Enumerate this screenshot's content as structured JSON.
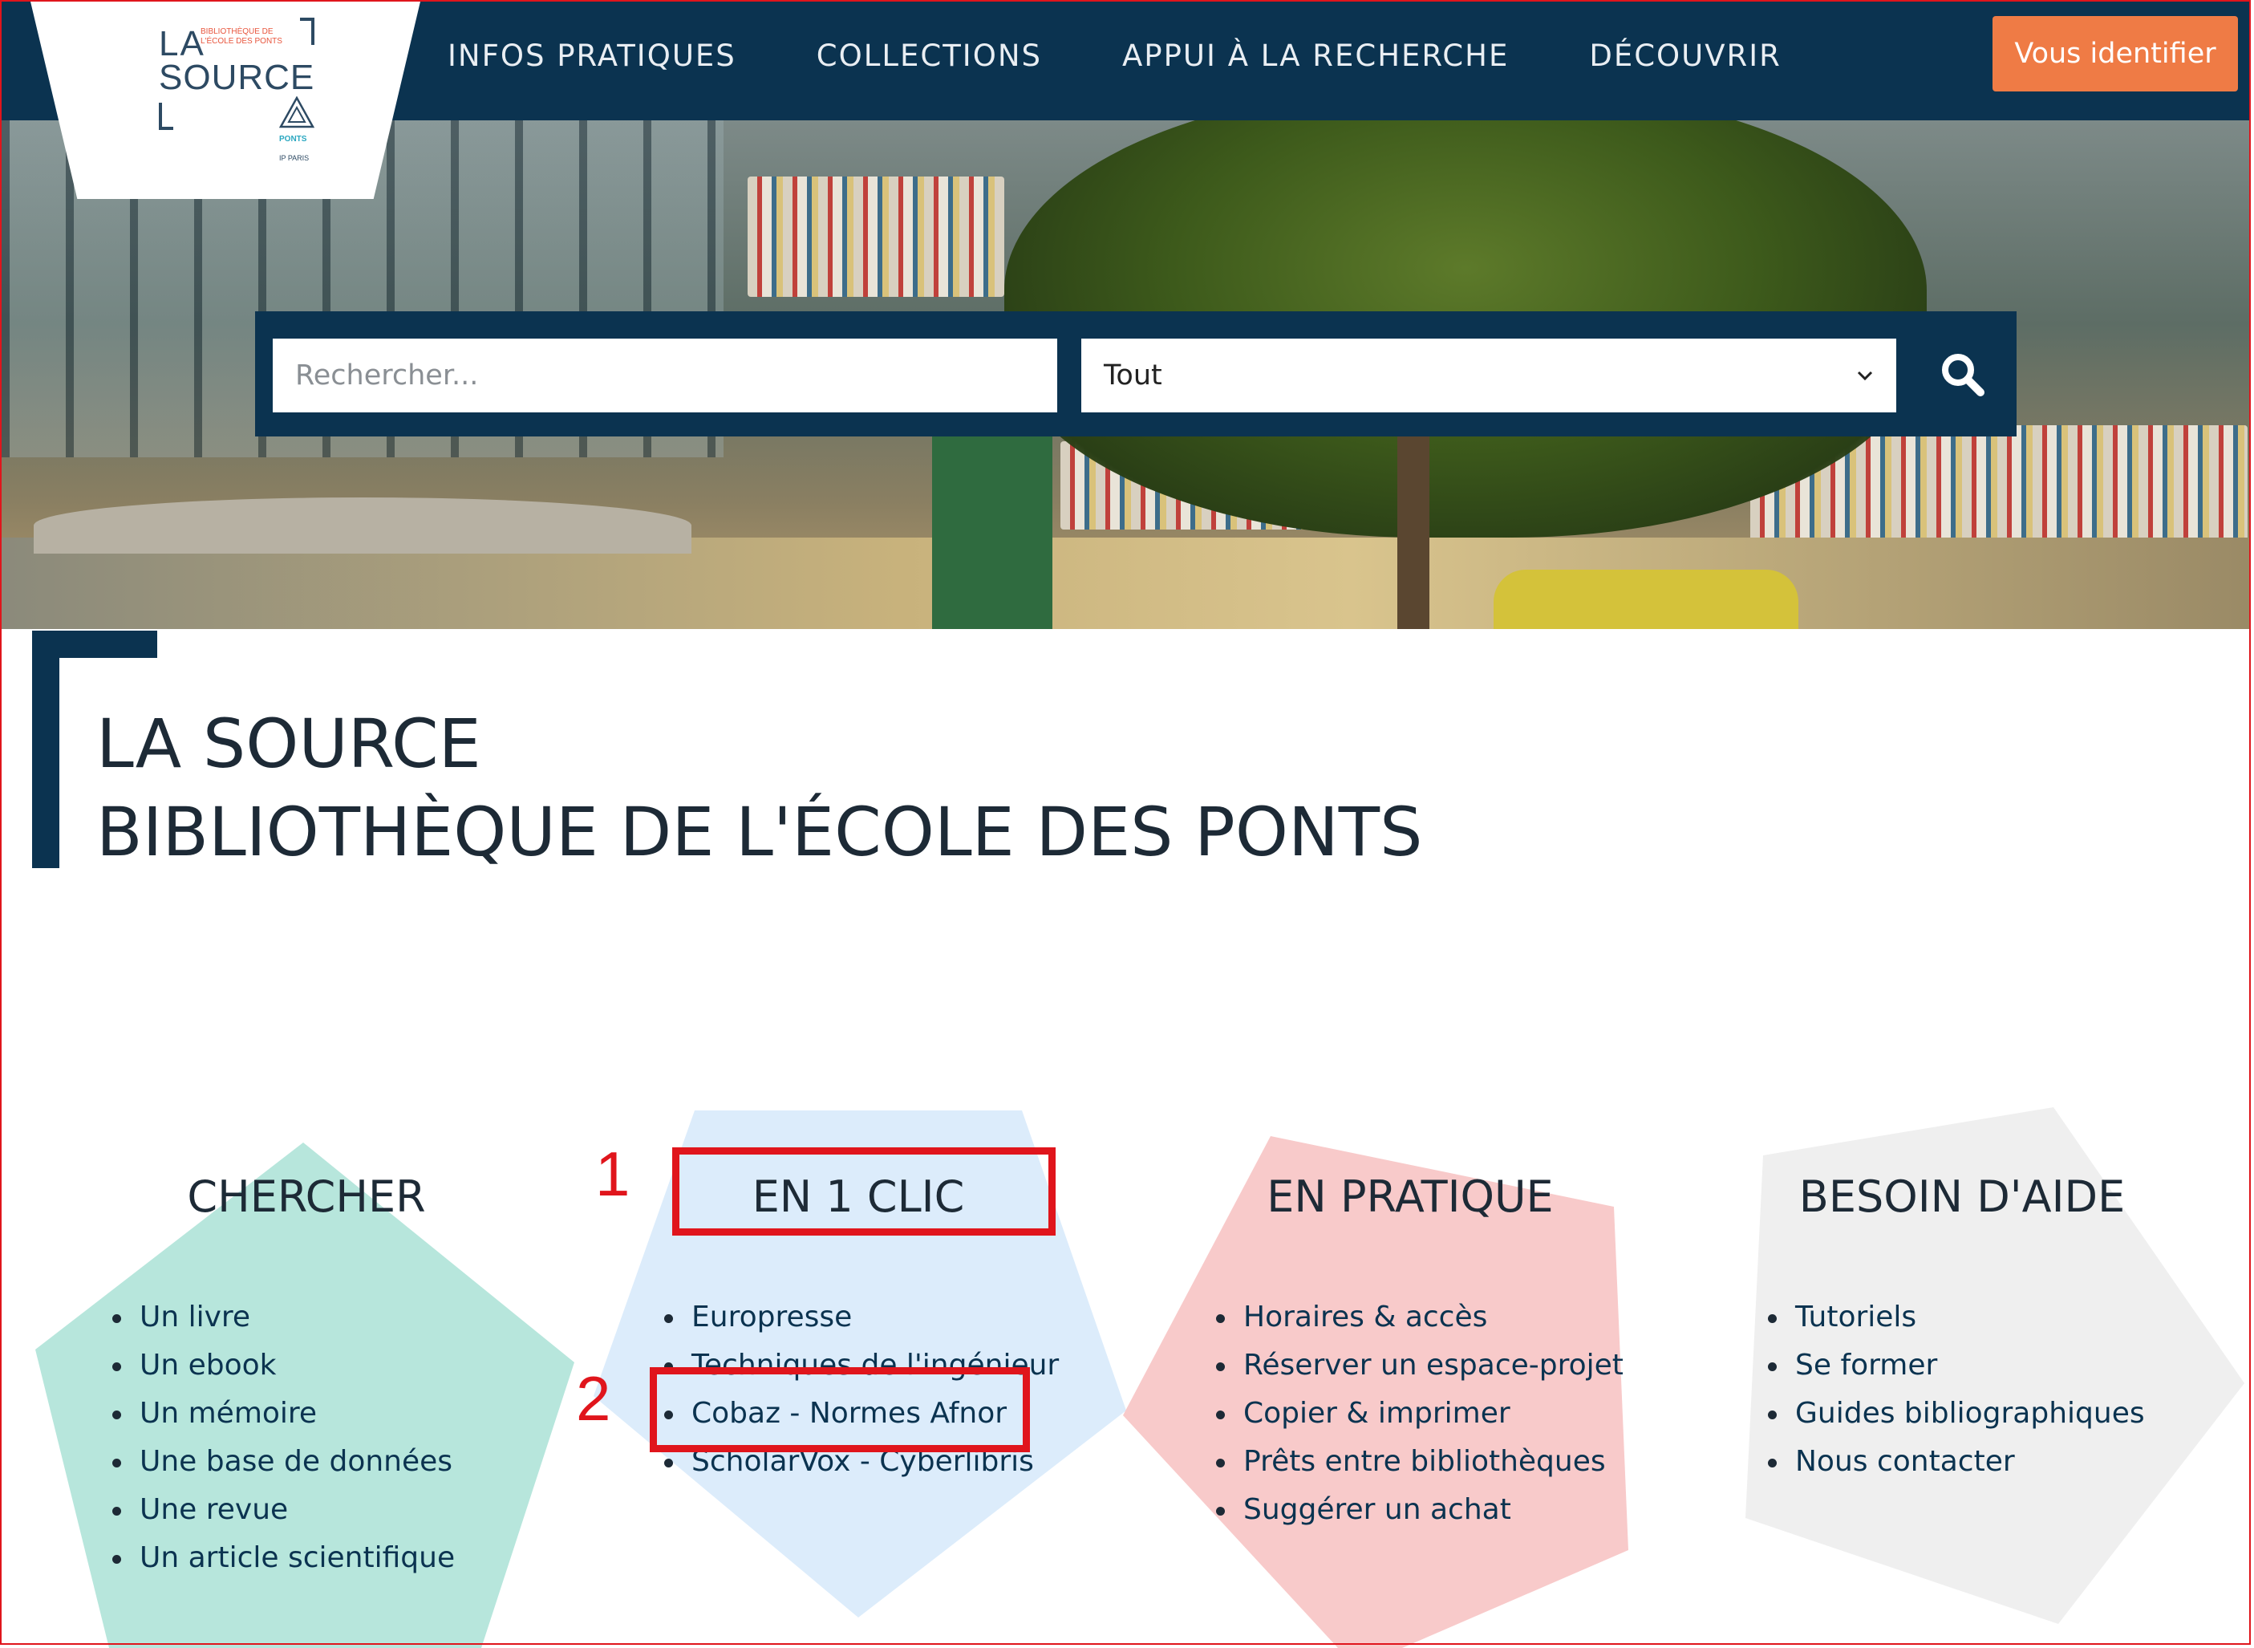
{
  "nav": {
    "items": [
      "INFOS PRATIQUES",
      "COLLECTIONS",
      "APPUI À LA RECHERCHE",
      "DÉCOUVRIR"
    ],
    "login_label": "Vous identifier"
  },
  "logo": {
    "line1": "LA",
    "line2": "SOURCE",
    "subtitle": "BIBLIOTHÈQUE DE L'ÉCOLE DES PONTS",
    "school": "PONTS",
    "group": "IP PARIS"
  },
  "search": {
    "placeholder": "Rechercher...",
    "scope_selected": "Tout"
  },
  "title": {
    "line1": "LA SOURCE",
    "line2": "BIBLIOTHÈQUE DE L'ÉCOLE DES PONTS"
  },
  "sections": [
    {
      "heading": "CHERCHER",
      "color": "#b7e6dc",
      "links": [
        "Un livre",
        "Un ebook",
        "Un mémoire",
        "Une base de données",
        "Une revue",
        "Un article scientifique"
      ]
    },
    {
      "heading": "EN 1 CLIC",
      "color": "#dcecfb",
      "links": [
        "Europresse",
        "Techniques de l'ingénieur",
        "Cobaz - Normes Afnor",
        "ScholarVox - Cyberlibris"
      ]
    },
    {
      "heading": "EN PRATIQUE",
      "color": "#f8caca",
      "links": [
        "Horaires & accès",
        "Réserver un espace-projet",
        "Copier & imprimer",
        "Prêts entre bibliothèques",
        "Suggérer un achat"
      ]
    },
    {
      "heading": "BESOIN D'AIDE",
      "color": "#efefef",
      "links": [
        "Tutoriels",
        "Se former",
        "Guides bibliographiques",
        "Nous contacter"
      ]
    }
  ],
  "annotations": {
    "step1": "1",
    "step2": "2",
    "color": "#e0151c"
  },
  "colors": {
    "navy": "#0b3350",
    "accent": "#ef7b45"
  }
}
